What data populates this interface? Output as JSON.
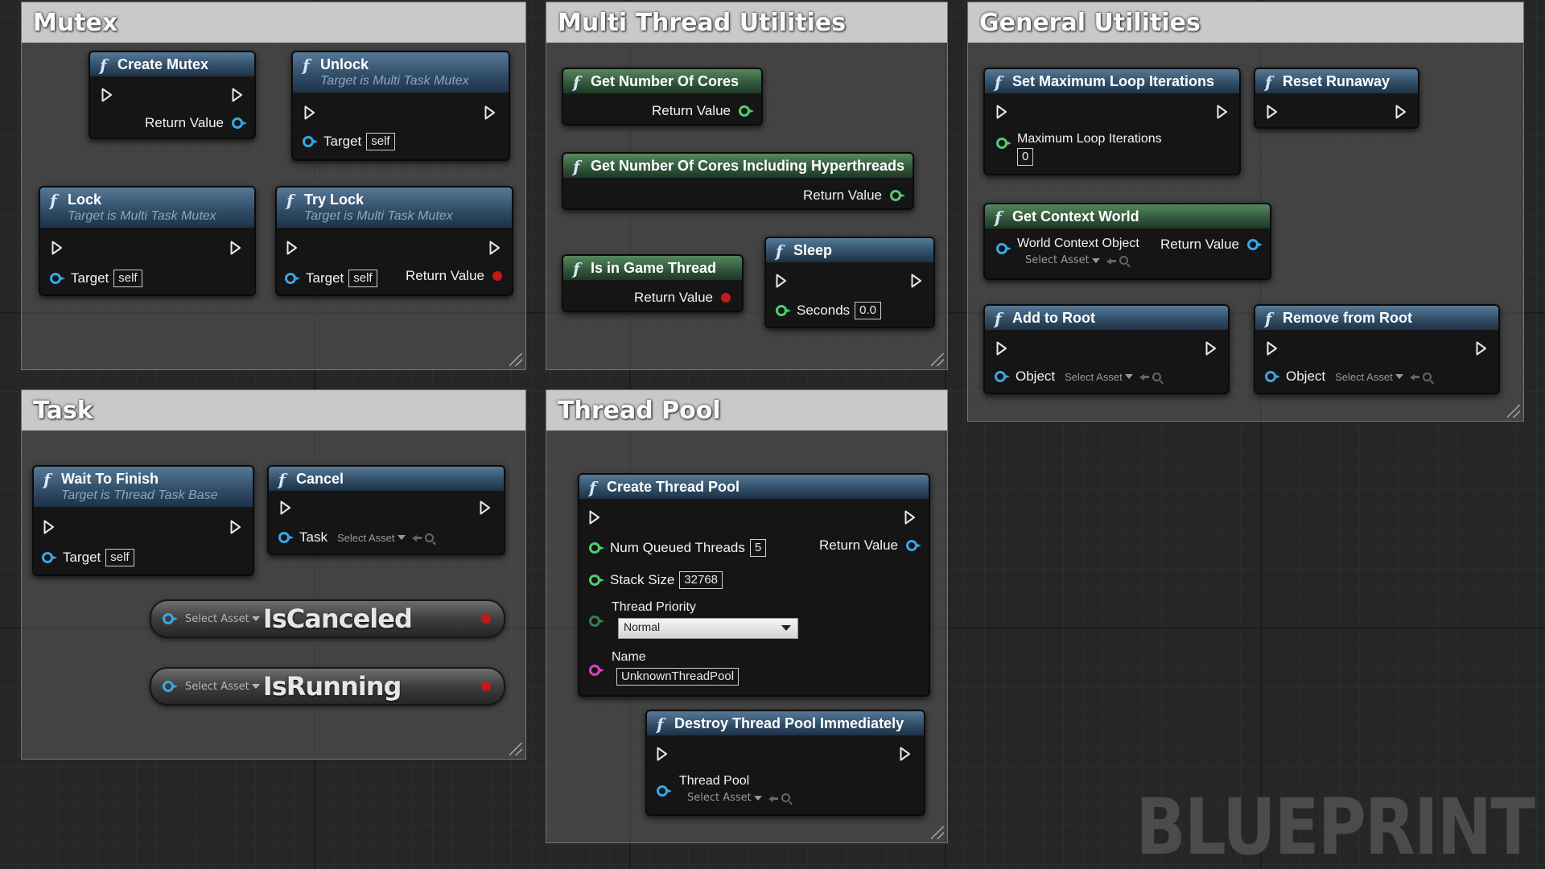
{
  "groups": {
    "mutex": "Mutex",
    "multi_thread": "Multi Thread Utilities",
    "general": "General Utilities",
    "task": "Task",
    "thread_pool": "Thread Pool"
  },
  "common": {
    "return_value": "Return Value",
    "target": "Target",
    "self": "self",
    "select_asset": "Select Asset",
    "function_glyph": "f"
  },
  "nodes": {
    "create_mutex": {
      "title": "Create Mutex"
    },
    "unlock": {
      "title": "Unlock",
      "subtitle": "Target is Multi Task Mutex"
    },
    "lock": {
      "title": "Lock",
      "subtitle": "Target is Multi Task Mutex"
    },
    "try_lock": {
      "title": "Try Lock",
      "subtitle": "Target is Multi Task Mutex"
    },
    "get_cores": {
      "title": "Get Number Of Cores"
    },
    "get_cores_ht": {
      "title": "Get Number Of Cores Including Hyperthreads"
    },
    "is_game_thread": {
      "title": "Is in Game Thread"
    },
    "sleep": {
      "title": "Sleep",
      "seconds_label": "Seconds",
      "seconds_value": "0.0"
    },
    "set_max_loop": {
      "title": "Set Maximum Loop Iterations",
      "param_label": "Maximum Loop Iterations",
      "param_value": "0"
    },
    "reset_runaway": {
      "title": "Reset Runaway"
    },
    "get_context_world": {
      "title": "Get Context World",
      "param_label": "World Context Object"
    },
    "add_to_root": {
      "title": "Add to Root",
      "param_label": "Object"
    },
    "remove_from_root": {
      "title": "Remove from Root",
      "param_label": "Object"
    },
    "wait_to_finish": {
      "title": "Wait To Finish",
      "subtitle": "Target is Thread Task Base"
    },
    "cancel": {
      "title": "Cancel",
      "param_label": "Task"
    },
    "create_thread_pool": {
      "title": "Create Thread Pool",
      "num_threads_label": "Num Queued Threads",
      "num_threads_value": "5",
      "stack_size_label": "Stack Size",
      "stack_size_value": "32768",
      "priority_label": "Thread Priority",
      "priority_value": "Normal",
      "name_label": "Name",
      "name_value": "UnknownThreadPool"
    },
    "destroy_thread_pool": {
      "title": "Destroy Thread Pool Immediately",
      "param_label": "Thread Pool"
    }
  },
  "variables": {
    "is_canceled": "IsCanceled",
    "is_running": "IsRunning"
  },
  "watermark": "BLUEPRINT",
  "colors": {
    "object_pin": "#38a7ea",
    "int_pin": "#4fcf6e",
    "bool_pin": "#c41919",
    "string_pin": "#e03cc7",
    "impure_header": "#2f4b64",
    "pure_header": "#30553a"
  }
}
